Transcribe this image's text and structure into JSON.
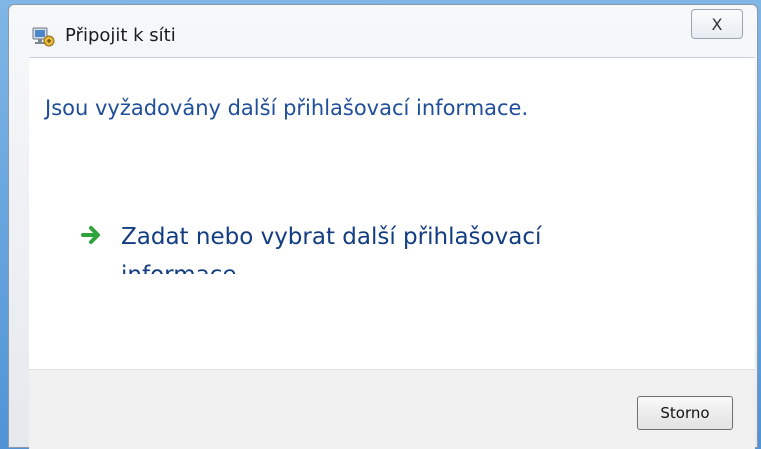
{
  "window": {
    "title": "Připojit k síti",
    "close_label": "X"
  },
  "icons": {
    "title": "network-connect-icon",
    "close": "close-icon",
    "arrow": "green-arrow-icon"
  },
  "content": {
    "headline": "Jsou vyžadovány další přihlašovací informace.",
    "command_link": "Zadat nebo vybrat další přihlašovací informace"
  },
  "footer": {
    "cancel_label": "Storno"
  },
  "colors": {
    "headline": "#1f4e9a",
    "command": "#123d80",
    "arrow": "#2fa43a",
    "desktop": "#4f93d6"
  }
}
